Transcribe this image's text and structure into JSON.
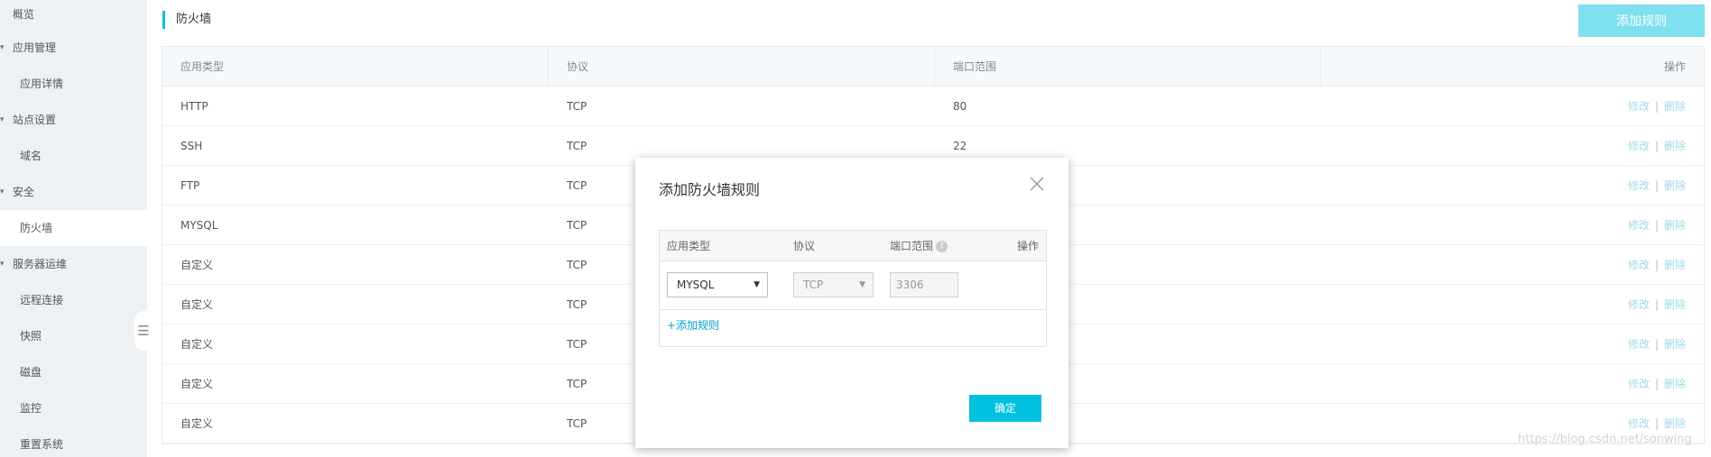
{
  "sidebar": {
    "items": [
      {
        "label": "概览",
        "type": "group",
        "caret": false
      },
      {
        "label": "应用管理",
        "type": "group",
        "caret": true
      },
      {
        "label": "应用详情",
        "type": "sub"
      },
      {
        "label": "站点设置",
        "type": "group",
        "caret": true
      },
      {
        "label": "域名",
        "type": "sub"
      },
      {
        "label": "安全",
        "type": "group",
        "caret": true
      },
      {
        "label": "防火墙",
        "type": "sub",
        "active": true
      },
      {
        "label": "服务器运维",
        "type": "group",
        "caret": true
      },
      {
        "label": "远程连接",
        "type": "sub"
      },
      {
        "label": "快照",
        "type": "sub"
      },
      {
        "label": "磁盘",
        "type": "sub"
      },
      {
        "label": "监控",
        "type": "sub"
      },
      {
        "label": "重置系统",
        "type": "sub"
      }
    ],
    "collapse_icon": "menu-icon"
  },
  "page": {
    "title": "防火墙",
    "add_button": "添加规则"
  },
  "table": {
    "headers": [
      "应用类型",
      "协议",
      "端口范围",
      "操作"
    ],
    "rows": [
      {
        "type": "HTTP",
        "protocol": "TCP",
        "port": "80"
      },
      {
        "type": "SSH",
        "protocol": "TCP",
        "port": "22"
      },
      {
        "type": "FTP",
        "protocol": "TCP",
        "port": ""
      },
      {
        "type": "MYSQL",
        "protocol": "TCP",
        "port": ""
      },
      {
        "type": "自定义",
        "protocol": "TCP",
        "port": ""
      },
      {
        "type": "自定义",
        "protocol": "TCP",
        "port": ""
      },
      {
        "type": "自定义",
        "protocol": "TCP",
        "port": ""
      },
      {
        "type": "自定义",
        "protocol": "TCP",
        "port": ""
      },
      {
        "type": "自定义",
        "protocol": "TCP",
        "port": ""
      }
    ],
    "edit_label": "修改",
    "separator": "|",
    "delete_label": "删除"
  },
  "modal": {
    "title": "添加防火墙规则",
    "headers": {
      "type": "应用类型",
      "protocol": "协议",
      "port": "端口范围",
      "op": "操作"
    },
    "help_glyph": "?",
    "row": {
      "type_value": "MYSQL",
      "protocol_value": "TCP",
      "port_value": "3306"
    },
    "arrow_glyph": "▼",
    "add_row_link": "+添加规则",
    "confirm_button": "确定"
  },
  "watermark": "https://blog.csdn.net/sonwing",
  "colors": {
    "accent": "#00c1de",
    "accent_light": "#7fe0ef",
    "link": "#9fd9e8"
  }
}
